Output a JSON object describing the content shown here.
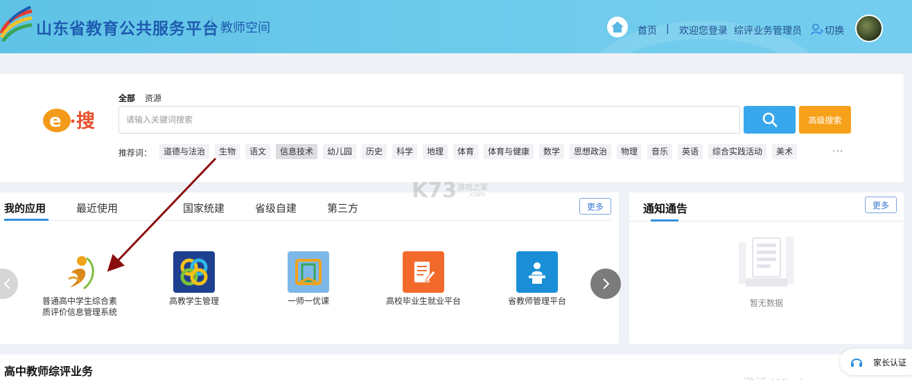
{
  "header": {
    "site_title": "山东省教育公共服务平台",
    "site_subtitle": "教师空间",
    "nav": {
      "home": "首页",
      "separator": "|",
      "welcome": "欢迎您登录",
      "role": "综评业务管理员",
      "switch": "切换"
    }
  },
  "search": {
    "tabs": [
      "全部",
      "资源"
    ],
    "placeholder": "请输入关键词搜索",
    "advanced_label": "高级搜索",
    "hot_label": "推荐词：",
    "tags": [
      "道德与法治",
      "生物",
      "语文",
      "信息技术",
      "幼儿园",
      "历史",
      "科学",
      "地理",
      "体育",
      "体育与健康",
      "数学",
      "思想政治",
      "物理",
      "音乐",
      "英语",
      "综合实践活动",
      "美术"
    ],
    "active_tag": "信息技术",
    "more": "···"
  },
  "apps": {
    "tabs": [
      "我的应用",
      "最近使用",
      "国家统建",
      "省级自建",
      "第三方"
    ],
    "more_label": "更多",
    "items": [
      {
        "line1": "普通高中学生综合素",
        "line2": "质评价信息管理系统"
      },
      {
        "line1": "高教学生管理",
        "line2": ""
      },
      {
        "line1": "一师一优课",
        "line2": ""
      },
      {
        "line1": "高校毕业生就业平台",
        "line2": ""
      },
      {
        "line1": "省教师管理平台",
        "line2": ""
      }
    ]
  },
  "notice": {
    "title": "通知通告",
    "more_label": "更多",
    "empty": "暂无数据"
  },
  "bottom": {
    "section_title": "高中教师综评业务",
    "parent_auth": "家长认证",
    "windows_watermark": "激活 Wind"
  },
  "watermark": {
    "k73": "K73",
    "sub": "游戏之家",
    "com": ".com"
  },
  "colors": {
    "header_bg": "#6fcbec",
    "brand_blue": "#1e5bb0",
    "search_button": "#38a7ec",
    "advanced_button": "#f7a11a",
    "tab_underline": "#2f8fe0",
    "annotation_arrow": "#8b0e0e"
  }
}
